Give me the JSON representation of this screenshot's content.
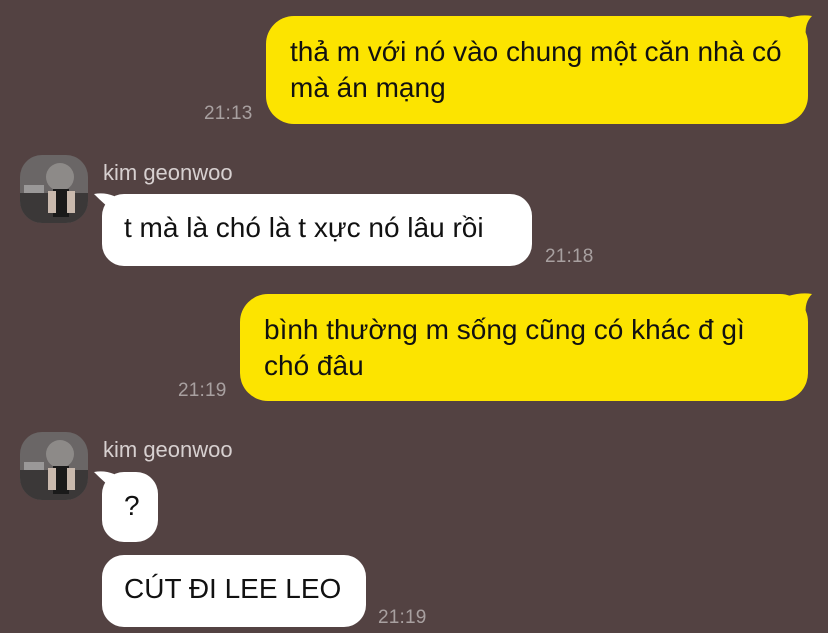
{
  "messages": [
    {
      "side": "out",
      "text": "thả m với nó vào chung một căn nhà có mà án mạng",
      "time": "21:13"
    },
    {
      "side": "in",
      "sender": "kim geonwoo",
      "text": "t mà là chó là t xực nó lâu rồi",
      "time": "21:18"
    },
    {
      "side": "out",
      "text": "bình thường m sống cũng có khác đ gì chó đâu",
      "time": "21:19"
    },
    {
      "side": "in",
      "sender": "kim geonwoo",
      "text": "?"
    },
    {
      "side": "in",
      "text": "CÚT ĐI LEE LEO",
      "time": "21:19"
    }
  ],
  "colors": {
    "background": "#534242",
    "outgoing_bubble": "#FCE400",
    "incoming_bubble": "#FFFFFF",
    "timestamp": "#A8A0A0",
    "sender_name": "#D7D0D0"
  },
  "icons": [
    "avatar-image"
  ]
}
